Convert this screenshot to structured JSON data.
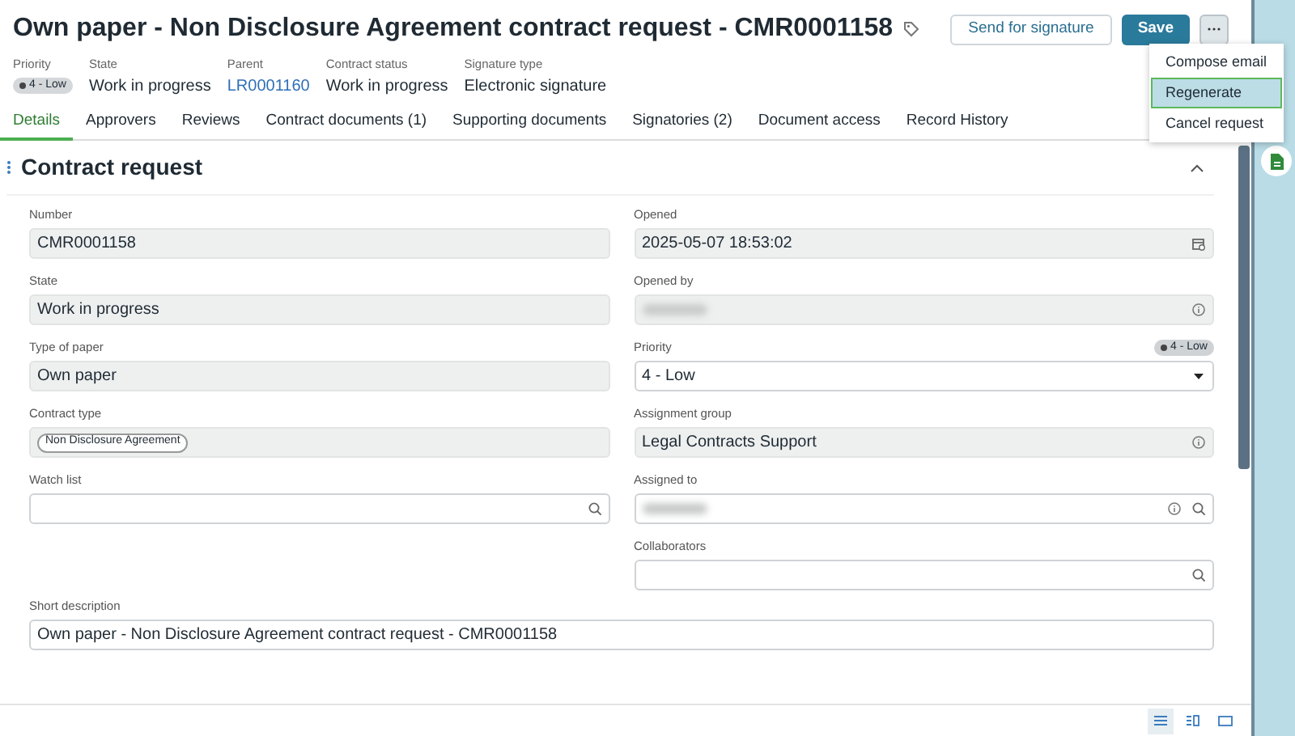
{
  "header": {
    "title": "Own paper - Non Disclosure Agreement contract request - CMR0001158",
    "actions": [
      {
        "label": "Send for signature",
        "kind": "secondary"
      },
      {
        "label": "Save",
        "kind": "primary"
      }
    ],
    "more_menu": {
      "expanded": true,
      "items": [
        {
          "label": "Compose email",
          "selected": false
        },
        {
          "label": "Regenerate",
          "selected": true
        },
        {
          "label": "Cancel request",
          "selected": false
        }
      ]
    }
  },
  "summary": [
    {
      "label": "Priority",
      "value": "4 - Low",
      "kind": "badge"
    },
    {
      "label": "State",
      "value": "Work in progress",
      "kind": "text"
    },
    {
      "label": "Parent",
      "value": "LR0001160",
      "kind": "link"
    },
    {
      "label": "Contract status",
      "value": "Work in progress",
      "kind": "text"
    },
    {
      "label": "Signature type",
      "value": "Electronic signature",
      "kind": "text"
    }
  ],
  "tabs": [
    {
      "label": "Details",
      "selected": true
    },
    {
      "label": "Approvers",
      "selected": false
    },
    {
      "label": "Reviews",
      "selected": false
    },
    {
      "label": "Contract documents (1)",
      "selected": false
    },
    {
      "label": "Supporting documents",
      "selected": false
    },
    {
      "label": "Signatories (2)",
      "selected": false
    },
    {
      "label": "Document access",
      "selected": false
    },
    {
      "label": "Record History",
      "selected": false
    }
  ],
  "section": {
    "title": "Contract request",
    "expanded": true,
    "left": [
      {
        "label": "Number",
        "value": "CMR0001158",
        "readonly": true,
        "kind": "text"
      },
      {
        "label": "State",
        "value": "Work in progress",
        "readonly": true,
        "kind": "text"
      },
      {
        "label": "Type of paper",
        "value": "Own paper",
        "readonly": true,
        "kind": "text"
      },
      {
        "label": "Contract type",
        "tags": [
          "Non Disclosure Agreement"
        ],
        "readonly": true,
        "kind": "text"
      },
      {
        "label": "Watch list",
        "readonly": false,
        "kind": "list"
      }
    ],
    "right": [
      {
        "label": "Opened",
        "value": "2025-05-07 18:53:02",
        "readonly": true,
        "kind": "date"
      },
      {
        "label": "Opened by",
        "redacted": true,
        "readonly": true,
        "kind": "reference"
      },
      {
        "label": "Priority",
        "value": "4 - Low",
        "badge": "4 - Low",
        "readonly": false,
        "kind": "select"
      },
      {
        "label": "Assignment group",
        "value": "Legal Contracts Support",
        "readonly": true,
        "kind": "reference"
      },
      {
        "label": "Assigned to",
        "redacted": true,
        "readonly": false,
        "kind": "lookup"
      },
      {
        "label": "Collaborators",
        "readonly": false,
        "kind": "list"
      }
    ],
    "full": [
      {
        "label": "Short description",
        "value": "Own paper - Non Disclosure Agreement contract request - CMR0001158",
        "readonly": false,
        "kind": "text"
      }
    ]
  },
  "view_options": [
    {
      "kind": "list",
      "selected": true
    },
    {
      "kind": "split",
      "selected": false
    },
    {
      "kind": "card",
      "selected": false
    }
  ]
}
